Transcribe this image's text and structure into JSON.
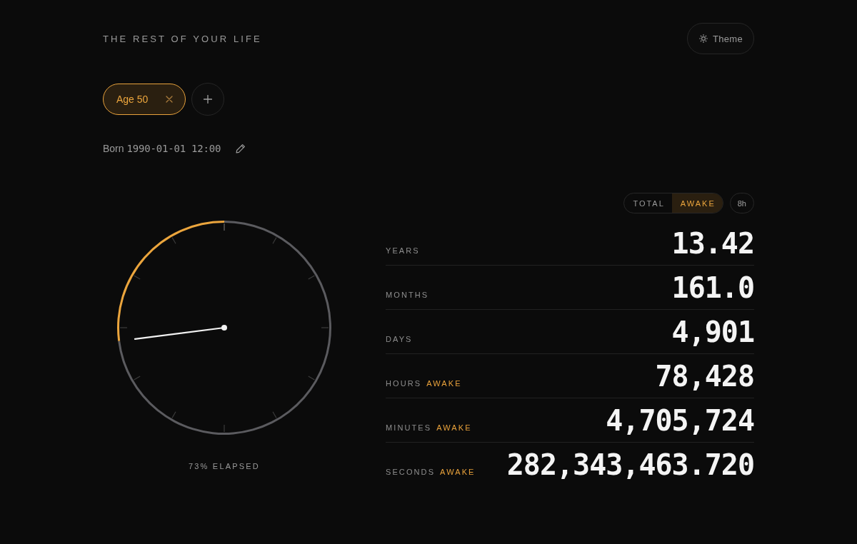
{
  "header": {
    "title": "THE REST OF YOUR LIFE",
    "theme_button": "Theme"
  },
  "profiles": [
    {
      "label": "Age 50",
      "selected": true
    }
  ],
  "birth": {
    "label": "Born",
    "value": "1990-01-01 12:00"
  },
  "dial": {
    "chart_data": {
      "type": "donut",
      "values": [
        73,
        27
      ]
    },
    "caption": "73% ELAPSED"
  },
  "mode_toggle": [
    {
      "label": "TOTAL",
      "selected": false
    },
    {
      "label": "AWAKE",
      "selected": true
    }
  ],
  "sleep_hours": "8h",
  "stats": [
    {
      "label": "YEARS",
      "value": "13.42"
    },
    {
      "label": "MONTHS",
      "value": "161.0"
    },
    {
      "label": "DAYS",
      "value": "4,901"
    },
    {
      "label": "HOURS",
      "qualifier": "AWAKE",
      "value": "78,428"
    },
    {
      "label": "MINUTES",
      "qualifier": "AWAKE",
      "value": "4,705,724"
    },
    {
      "label": "SECONDS",
      "qualifier": "AWAKE",
      "value": "282,343,463.720"
    }
  ]
}
